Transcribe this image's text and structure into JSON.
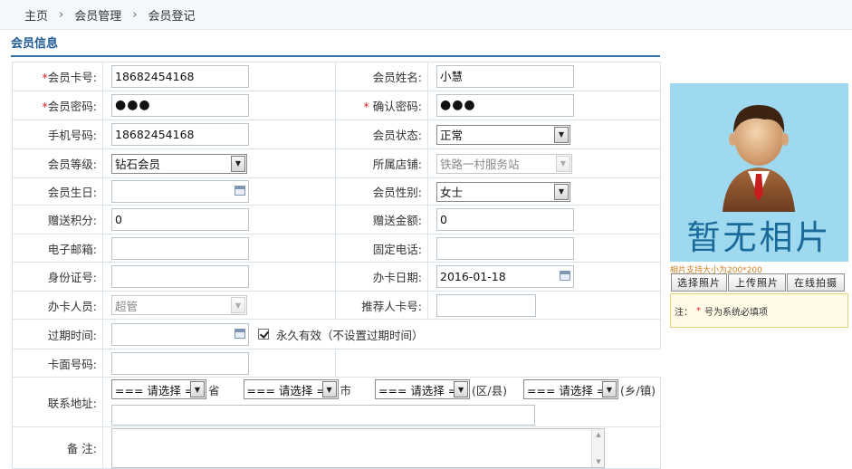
{
  "breadcrumb": [
    "主页",
    "会员管理",
    "会员登记"
  ],
  "breadcrumb_sep": "›",
  "section_title": "会员信息",
  "required_mark": "*",
  "fields": {
    "card_no_label": "会员卡号:",
    "card_no_value": "18682454168",
    "name_label": "会员姓名:",
    "name_value": "小慧",
    "password_label": "会员密码:",
    "password_value": "●●●",
    "confirm_label": "确认密码:",
    "confirm_value": "●●●",
    "phone_label": "手机号码:",
    "phone_value": "18682454168",
    "status_label": "会员状态:",
    "status_value": "正常",
    "level_label": "会员等级:",
    "level_value": "钻石会员",
    "store_label": "所属店铺:",
    "store_value": "铁路一村服务站",
    "birthday_label": "会员生日:",
    "birthday_value": "",
    "gender_label": "会员性别:",
    "gender_value": "女士",
    "points_label": "赠送积分:",
    "points_value": "0",
    "amount_label": "赠送金额:",
    "amount_value": "0",
    "email_label": "电子邮箱:",
    "email_value": "",
    "tel_label": "固定电话:",
    "tel_value": "",
    "idcard_label": "身份证号:",
    "idcard_value": "",
    "issue_date_label": "办卡日期:",
    "issue_date_value": "2016-01-18",
    "operator_label": "办卡人员:",
    "operator_value": "超管",
    "referrer_label": "推荐人卡号:",
    "referrer_value": "",
    "expire_label": "过期时间:",
    "expire_value": "",
    "permanent_label": "永久有效（不设置过期时间）",
    "face_no_label": "卡面号码:",
    "face_no_value": "",
    "address_label": "联系地址:",
    "address_province": "=== 请选择 ===",
    "address_province_unit": "省",
    "address_city": "=== 请选择 ===",
    "address_city_unit": "市",
    "address_district": "=== 请选择 ===",
    "address_district_unit": "(区/县)",
    "address_town": "=== 请选择 ===",
    "address_town_unit": "(乡/镇)",
    "address_detail": "",
    "remark_label": "备  注:",
    "remark_value": ""
  },
  "photo": {
    "placeholder_text": "暂无相片",
    "tip": "相片支持大小为200*200",
    "btn_select": "选择照片",
    "btn_upload": "上传照片",
    "btn_capture": "在线拍摄"
  },
  "note": {
    "prefix": "注：",
    "mark": "*",
    "text": "号为系统必填项"
  },
  "colors": {
    "accent": "#2f71ab",
    "required": "#e02020",
    "photo_bg": "#9fd9ef"
  }
}
